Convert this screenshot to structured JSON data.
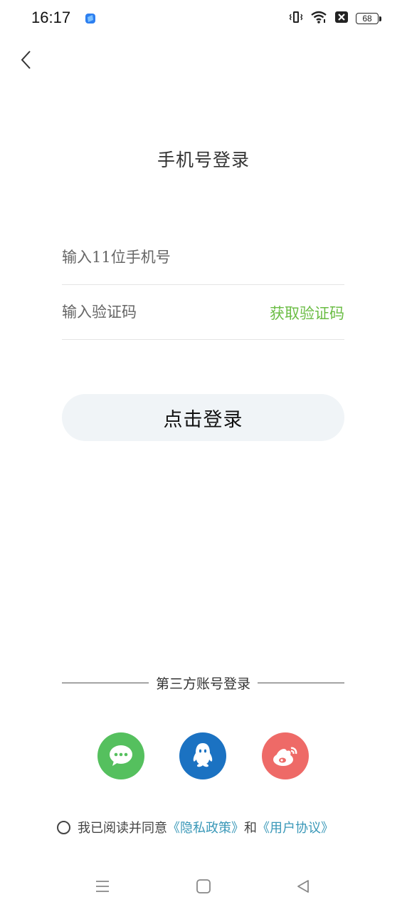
{
  "status_bar": {
    "time": "16:17",
    "battery_level": "68"
  },
  "page": {
    "title": "手机号登录"
  },
  "form": {
    "phone_placeholder": "输入11位手机号",
    "code_placeholder": "输入验证码",
    "get_code_label": "获取验证码",
    "login_label": "点击登录"
  },
  "third_party": {
    "label": "第三方账号登录",
    "providers": [
      {
        "name": "wechat",
        "icon": "wechat-icon",
        "color": "#55c05e"
      },
      {
        "name": "qq",
        "icon": "qq-icon",
        "color": "#1b72c2"
      },
      {
        "name": "weibo",
        "icon": "weibo-icon",
        "color": "#ee6a67"
      }
    ]
  },
  "agreement": {
    "prefix": "我已阅读并同意",
    "privacy_link": "《隐私政策》",
    "conjunction": "和",
    "terms_link": "《用户协议》"
  },
  "colors": {
    "accent_green": "#6bbd45",
    "link_blue": "#3a98b8",
    "button_bg": "#f0f4f7"
  },
  "nav_bar": {
    "icons": [
      "menu-icon",
      "home-icon",
      "back-triangle-icon"
    ]
  }
}
